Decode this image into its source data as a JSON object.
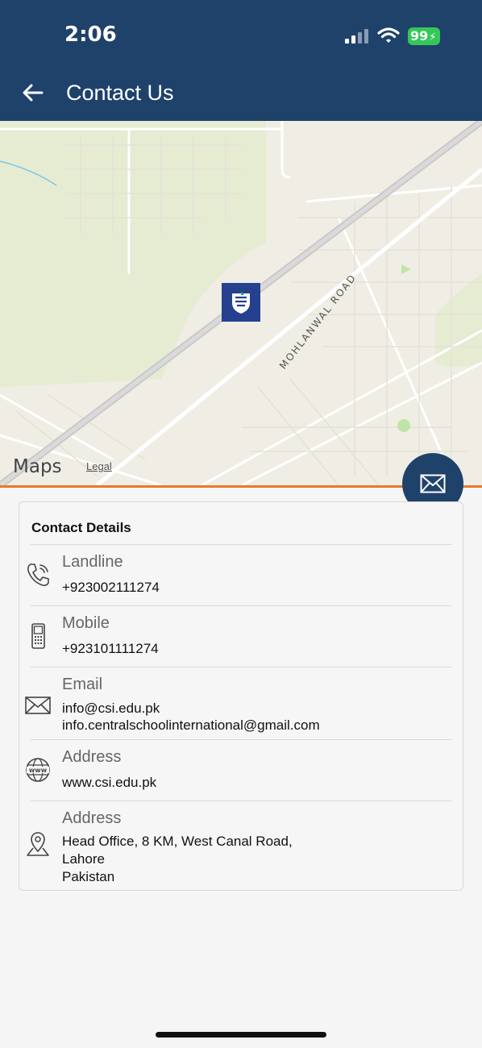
{
  "status_bar": {
    "time": "2:06",
    "battery": "99"
  },
  "header": {
    "title": "Contact Us"
  },
  "map": {
    "road_label": "MOHLANWAL ROAD",
    "maps_brand": "Maps",
    "legal": "Legal"
  },
  "colors": {
    "header": "#1f426b",
    "accent_line": "#e8792b",
    "marker": "#25408f",
    "battery": "#35c759"
  },
  "contact": {
    "title": "Contact Details",
    "rows": [
      {
        "icon": "phone-icon",
        "label": "Landline",
        "lines": [
          "+923002111274"
        ]
      },
      {
        "icon": "mobile-phone-icon",
        "label": "Mobile",
        "lines": [
          "+923101111274"
        ]
      },
      {
        "icon": "envelope-icon",
        "label": "Email",
        "lines": [
          "info@csi.edu.pk",
          "info.centralschoolinternational@gmail.com"
        ]
      },
      {
        "icon": "globe-www-icon",
        "label": "Address",
        "lines": [
          "www.csi.edu.pk"
        ]
      },
      {
        "icon": "location-pin-icon",
        "label": "Address",
        "lines": [
          "Head Office, 8 KM, West Canal Road,",
          "Lahore",
          "Pakistan"
        ]
      }
    ]
  }
}
